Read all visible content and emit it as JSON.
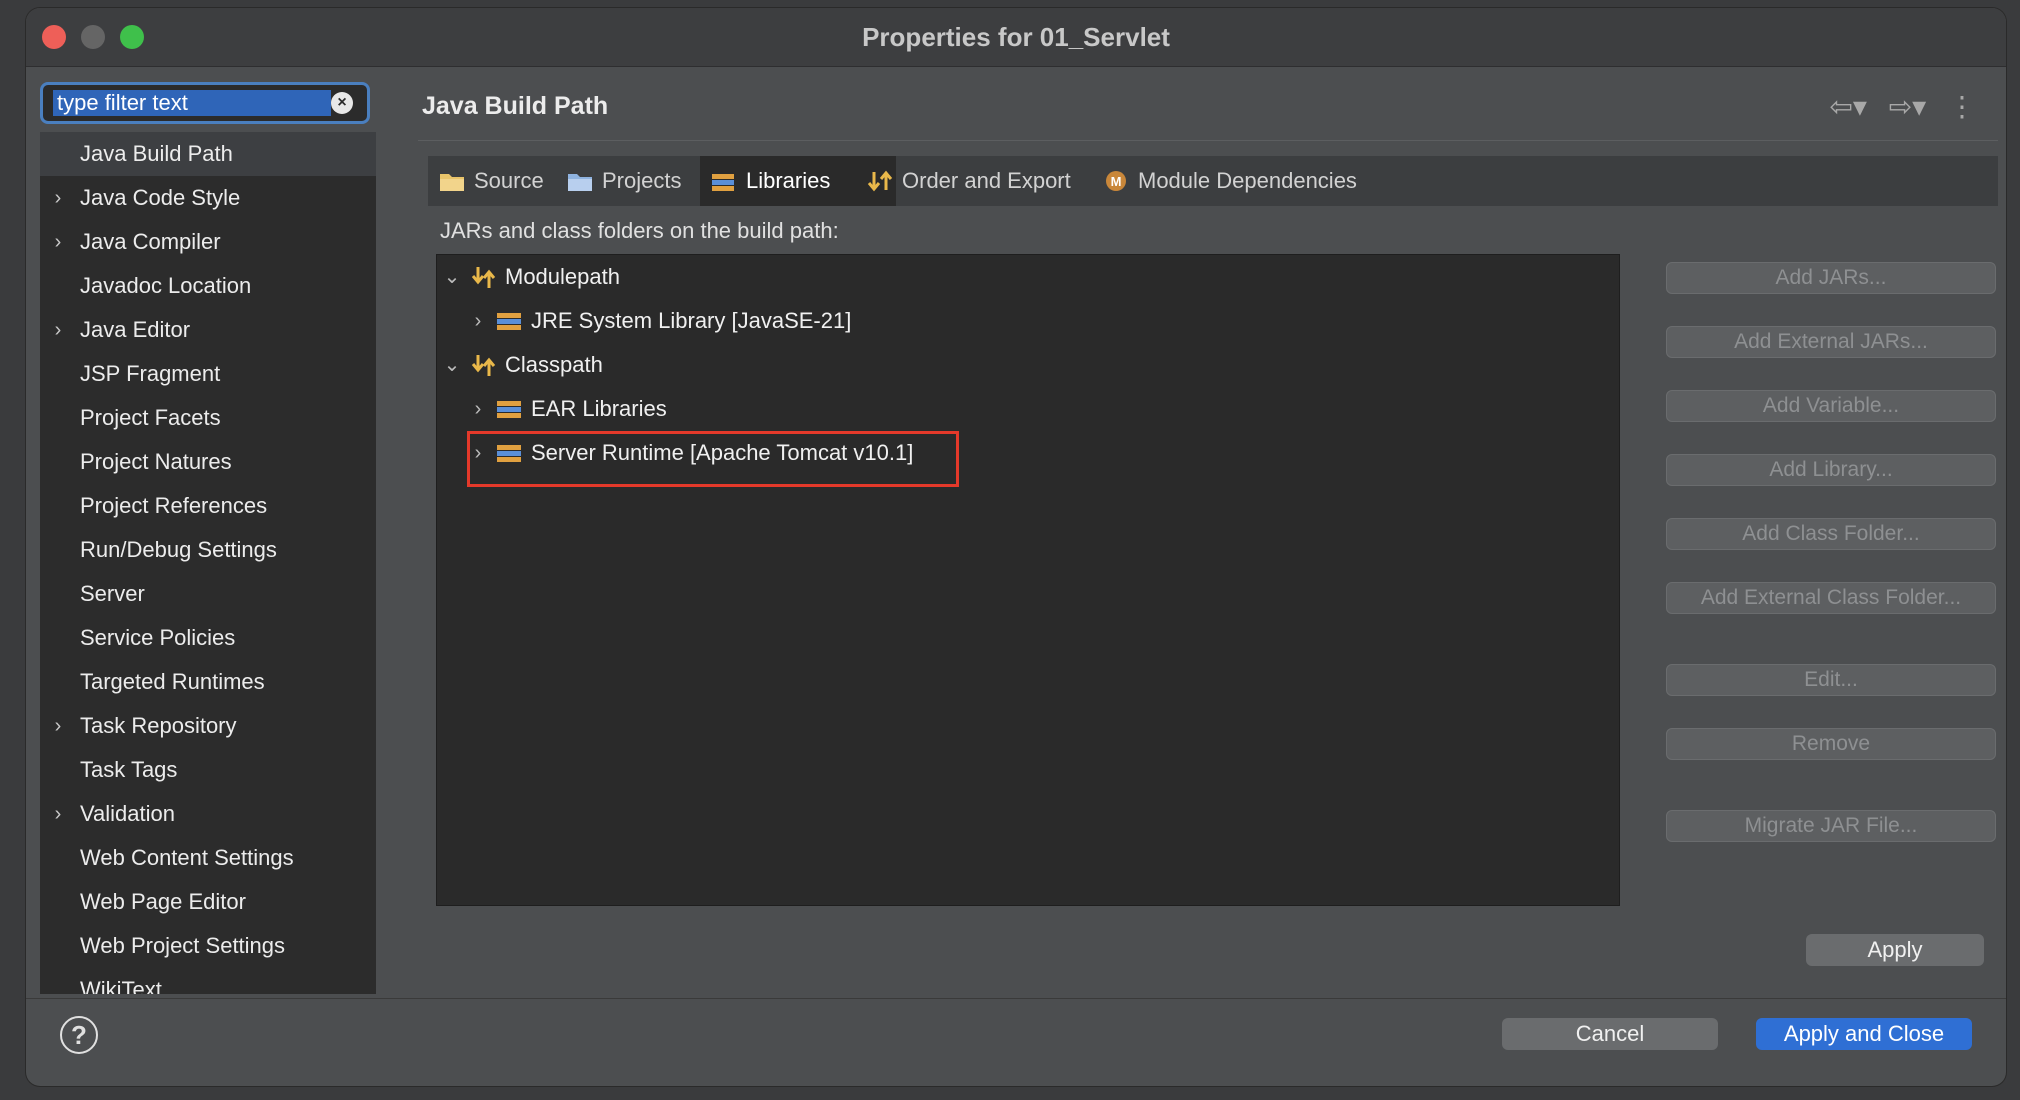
{
  "window": {
    "title": "Properties for 01_Servlet"
  },
  "filter": {
    "placeholder": "type filter text"
  },
  "nav": {
    "items": [
      {
        "label": "Java Build Path",
        "expandable": false,
        "selected": true
      },
      {
        "label": "Java Code Style",
        "expandable": true
      },
      {
        "label": "Java Compiler",
        "expandable": true
      },
      {
        "label": "Javadoc Location",
        "expandable": false
      },
      {
        "label": "Java Editor",
        "expandable": true
      },
      {
        "label": "JSP Fragment",
        "expandable": false
      },
      {
        "label": "Project Facets",
        "expandable": false
      },
      {
        "label": "Project Natures",
        "expandable": false
      },
      {
        "label": "Project References",
        "expandable": false
      },
      {
        "label": "Run/Debug Settings",
        "expandable": false
      },
      {
        "label": "Server",
        "expandable": false
      },
      {
        "label": "Service Policies",
        "expandable": false
      },
      {
        "label": "Targeted Runtimes",
        "expandable": false
      },
      {
        "label": "Task Repository",
        "expandable": true
      },
      {
        "label": "Task Tags",
        "expandable": false
      },
      {
        "label": "Validation",
        "expandable": true
      },
      {
        "label": "Web Content Settings",
        "expandable": false
      },
      {
        "label": "Web Page Editor",
        "expandable": false
      },
      {
        "label": "Web Project Settings",
        "expandable": false
      },
      {
        "label": "WikiText",
        "expandable": false
      }
    ]
  },
  "page": {
    "title": "Java Build Path",
    "section_label": "JARs and class folders on the build path:"
  },
  "tabs": [
    {
      "label": "Source",
      "icon": "source-folder-icon"
    },
    {
      "label": "Projects",
      "icon": "projects-folder-icon"
    },
    {
      "label": "Libraries",
      "icon": "libraries-icon",
      "active": true
    },
    {
      "label": "Order and Export",
      "icon": "order-export-icon"
    },
    {
      "label": "Module Dependencies",
      "icon": "module-icon"
    }
  ],
  "tree": {
    "modulepath": {
      "label": "Modulepath"
    },
    "jre": {
      "label": "JRE System Library [JavaSE-21]"
    },
    "classpath": {
      "label": "Classpath"
    },
    "ear": {
      "label": "EAR Libraries"
    },
    "server_runtime": {
      "label": "Server Runtime [Apache Tomcat v10.1]"
    }
  },
  "side_buttons": {
    "add_jars": "Add JARs...",
    "add_external_jars": "Add External JARs...",
    "add_variable": "Add Variable...",
    "add_library": "Add Library...",
    "add_class_folder": "Add Class Folder...",
    "add_external_class_folder": "Add External Class Folder...",
    "edit": "Edit...",
    "remove": "Remove",
    "migrate_jar": "Migrate JAR File..."
  },
  "footer": {
    "apply": "Apply",
    "cancel": "Cancel",
    "apply_close": "Apply and Close",
    "help": "?"
  },
  "colors": {
    "accent": "#2f6fd4",
    "highlight": "#e4392a"
  }
}
